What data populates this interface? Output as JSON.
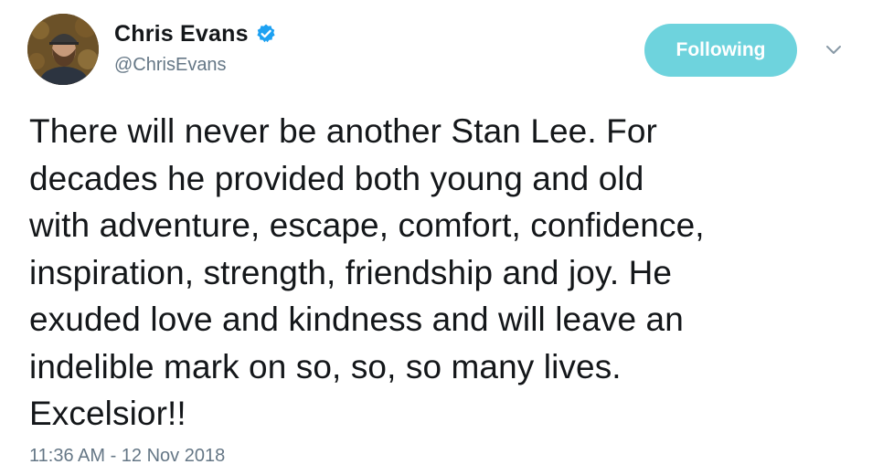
{
  "author": {
    "display_name": "Chris Evans",
    "handle": "@ChrisEvans",
    "verified": true,
    "verified_icon": "verified-badge-icon",
    "avatar_icon": "avatar-photo"
  },
  "follow_button": {
    "label": "Following",
    "color": "#6ed3dd"
  },
  "menu": {
    "icon": "chevron-down-icon"
  },
  "tweet": {
    "text": "There will never be another Stan Lee. For\ndecades he provided both young and old\nwith adventure, escape, comfort, confidence,\ninspiration, strength, friendship and joy. He\nexuded love and kindness and will leave an\nindelible mark on so, so, so many lives.\nExcelsior!!",
    "timestamp": "11:36 AM - 12 Nov 2018"
  },
  "colors": {
    "text": "#14171a",
    "secondary": "#657786",
    "verified": "#1da1f2"
  }
}
